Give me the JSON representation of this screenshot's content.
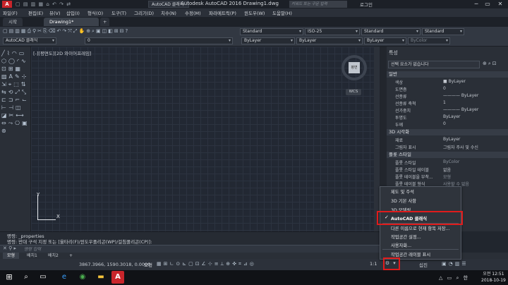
{
  "titlebar": {
    "logo": "A",
    "qat_text": "▢ ▤ ▥ ▦ ⌂ ↶ ↷ ⇄",
    "workspace_select": "AutoCAD 클래식",
    "title": "Autodesk AutoCAD 2016   Drawing1.dwg",
    "search_placeholder": "키워드 또는 구문 입력",
    "login": "로그인",
    "minimize": "─",
    "restore": "▭",
    "close": "✕"
  },
  "menubar": {
    "items": [
      "파일(F)",
      "편집(E)",
      "뷰(V)",
      "삽입(I)",
      "형식(O)",
      "도구(T)",
      "그리기(D)",
      "치수(N)",
      "수정(M)",
      "파라메트릭(P)",
      "윈도우(W)",
      "도움말(H)"
    ]
  },
  "tabs": {
    "start": "시작",
    "drawing": "Drawing1*",
    "add": "+"
  },
  "toolbar": {
    "workspace": "AutoCAD 클래식",
    "layer": "0",
    "style_text": "Standard",
    "dim_style": "ISO-25",
    "table_style": "Standard",
    "multileader_style": "Standard",
    "color": "ByLayer",
    "linetype": "ByLayer",
    "lineweight": "ByLayer",
    "plot_style": "ByColor"
  },
  "viewport": {
    "label": "[-][평면도][2D 와이어프레임]",
    "viewcube_face": "평면",
    "wcs": "WCS",
    "ucs_y": "Y",
    "ucs_x": "X"
  },
  "properties": {
    "title": "특성",
    "selection": "선택 요소가 없습니다",
    "sections": [
      {
        "name": "일반",
        "rows": [
          {
            "label": "색상",
            "value": "■ ByLayer"
          },
          {
            "label": "도면층",
            "value": "0"
          },
          {
            "label": "선종류",
            "value": "———— ByLayer"
          },
          {
            "label": "선종류 축척",
            "value": "1"
          },
          {
            "label": "선가중치",
            "value": "———— ByLayer"
          },
          {
            "label": "투명도",
            "value": "ByLayer"
          },
          {
            "label": "두께",
            "value": "0"
          }
        ]
      },
      {
        "name": "3D 시각화",
        "rows": [
          {
            "label": "재료",
            "value": "ByLayer"
          },
          {
            "label": "그림자 표시",
            "value": "그림자 주사 및 수신"
          }
        ]
      },
      {
        "name": "플롯 스타일",
        "rows": [
          {
            "label": "플롯 스타일",
            "value": "ByColor"
          },
          {
            "label": "플롯 스타일 테이블",
            "value": "없음"
          },
          {
            "label": "플롯 테이블을 부착...",
            "value": "모형"
          },
          {
            "label": "플롯 테이블 형식",
            "value": "사용할 수 없음"
          }
        ]
      }
    ]
  },
  "command": {
    "line1": "명령: _properties",
    "line2": "명령: 반대 구석 지정 또는 [울타리(F)/윈도우폴리곤(WP)/걸침폴리곤(CP)]:",
    "placeholder": "명령 입력"
  },
  "layout_tabs": [
    "모형",
    "배치1",
    "배치2",
    "+"
  ],
  "status": {
    "coords": "3867.3966, 1590.3018, 0.0000",
    "mode": "모형",
    "scale": "1:1",
    "workspace_label": "십진"
  },
  "workspace_menu": {
    "items": [
      {
        "label": "제도 및 주석",
        "checked": false
      },
      {
        "label": "3D 기본 사항",
        "checked": false
      },
      {
        "label": "3D 모델링",
        "checked": false
      },
      {
        "label": "AutoCAD 클래식",
        "checked": true
      },
      {
        "label": "다른 이름으로 현재 항목 저장...",
        "checked": false
      },
      {
        "label": "작업공간 설정...",
        "checked": false
      },
      {
        "label": "사용자화...",
        "checked": false
      },
      {
        "label": "작업공간 레이블 표시",
        "checked": false
      }
    ]
  },
  "taskbar": {
    "time": "오전 12:51",
    "date": "2018-10-19",
    "app_autocad": "A",
    "tray": "△ ▭ ⌕ 한"
  },
  "colors": {
    "highlight": "#e01b1b",
    "accent_red": "#c9252b"
  }
}
